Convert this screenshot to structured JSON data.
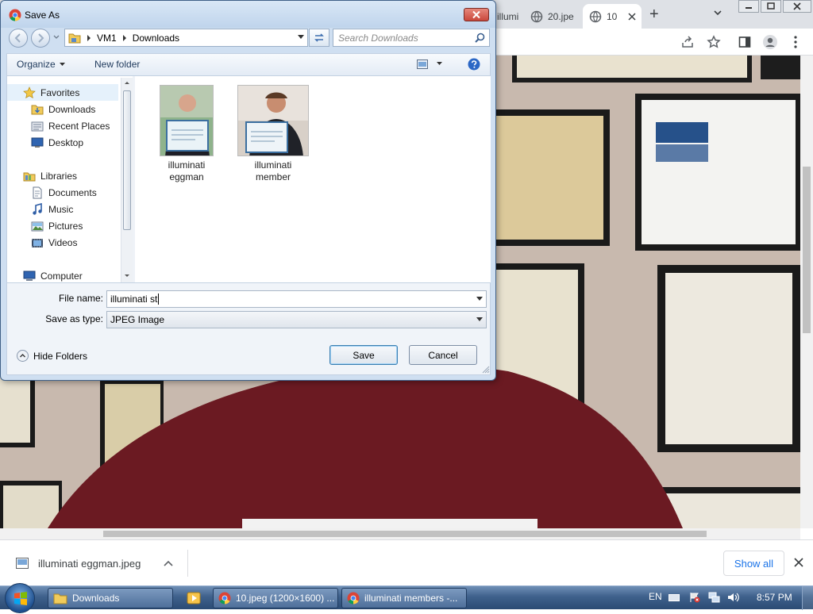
{
  "browser": {
    "tabs": [
      {
        "label": "illumi",
        "state": "partial"
      },
      {
        "label": "20.jpe",
        "state": "inactive"
      },
      {
        "label": "10",
        "state": "active"
      }
    ],
    "new_tab_glyph": "+",
    "download": {
      "filename": "illuminati eggman.jpeg",
      "show_all": "Show all"
    }
  },
  "dialog": {
    "title": "Save As",
    "breadcrumb": [
      "VM1",
      "Downloads"
    ],
    "search_placeholder": "Search Downloads",
    "organize": "Organize",
    "new_folder": "New folder",
    "nav": {
      "favorites": "Favorites",
      "favorites_items": [
        "Downloads",
        "Recent Places",
        "Desktop"
      ],
      "libraries": "Libraries",
      "libraries_items": [
        "Documents",
        "Music",
        "Pictures",
        "Videos"
      ],
      "computer": "Computer"
    },
    "files": [
      {
        "name_line1": "illuminati",
        "name_line2": "eggman"
      },
      {
        "name_line1": "illuminati",
        "name_line2": "member"
      }
    ],
    "file_name_label": "File name:",
    "file_name_value": "illuminati st",
    "save_type_label": "Save as type:",
    "save_type_value": "JPEG Image",
    "hide_folders": "Hide Folders",
    "save": "Save",
    "cancel": "Cancel"
  },
  "taskbar": {
    "items": [
      "Downloads",
      "10.jpeg (1200×1600) ...",
      "illuminati members -..."
    ],
    "lang": "EN",
    "time": "8:57 PM"
  },
  "colors": {
    "dialog_frame": "#cfdff1",
    "close_button": "#c9473b",
    "taskbar": "#3f618c",
    "link_blue": "#1a73e8"
  }
}
